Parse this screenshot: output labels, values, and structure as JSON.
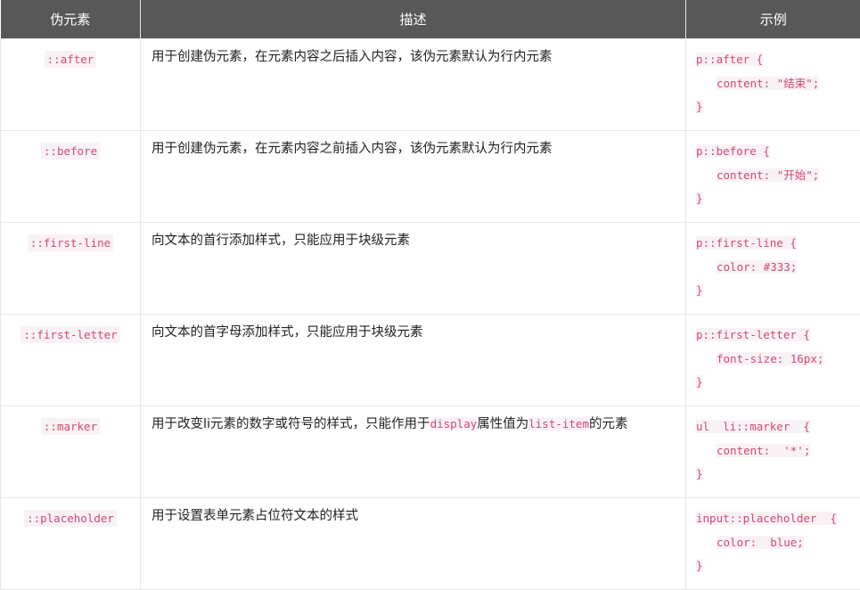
{
  "header": {
    "col1": "伪元素",
    "col2": "描述",
    "col3": "示例"
  },
  "rows": [
    {
      "name": "::after",
      "desc": "用于创建伪元素，在元素内容之后插入内容，该伪元素默认为行内元素",
      "example": [
        "p::after {",
        "content: \"结束\";",
        "}"
      ]
    },
    {
      "name": "::before",
      "desc": "用于创建伪元素，在元素内容之前插入内容，该伪元素默认为行内元素",
      "example": [
        "p::before {",
        "content: \"开始\";",
        "}"
      ]
    },
    {
      "name": "::first-line",
      "desc": "向文本的首行添加样式，只能应用于块级元素",
      "example": [
        "p::first-line {",
        "color: #333;",
        "}"
      ]
    },
    {
      "name": "::first-letter",
      "desc": "向文本的首字母添加样式，只能应用于块级元素",
      "example": [
        "p::first-letter {",
        "font-size: 16px;",
        "}"
      ]
    },
    {
      "name": "::marker",
      "desc_parts": [
        "用于改变li元素的数字或符号的样式，只能作用于",
        "display",
        "属性值为",
        "list-item",
        "的元素"
      ],
      "example": [
        "ul  li::marker  {",
        "content:  '*';",
        "}"
      ]
    },
    {
      "name": "::placeholder",
      "desc": "用于设置表单元素占位符文本的样式",
      "example": [
        "input::placeholder  {",
        "color:  blue;",
        "}"
      ]
    }
  ]
}
